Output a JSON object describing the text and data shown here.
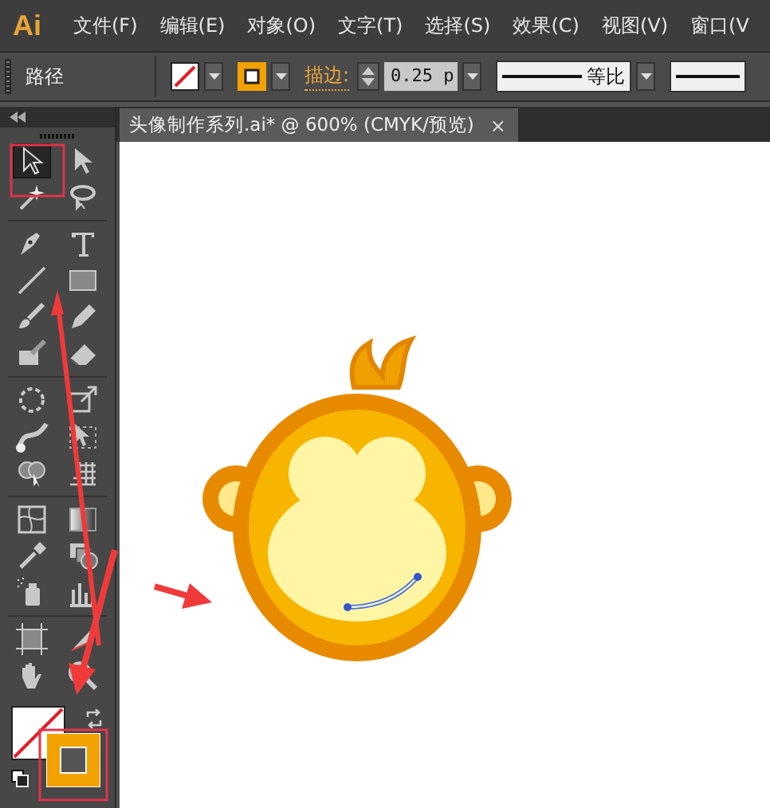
{
  "app_logo": "Ai",
  "menu": [
    "文件(F)",
    "编辑(E)",
    "对象(O)",
    "文字(T)",
    "选择(S)",
    "效果(C)",
    "视图(V)",
    "窗口(V"
  ],
  "control_bar": {
    "label": "路径",
    "stroke_label": "描边:",
    "stroke_weight": "0.25 p",
    "profile": "等比"
  },
  "document_tab": {
    "title": "头像制作系列.ai* @ 600% (CMYK/预览)",
    "close": "×"
  },
  "tools": [
    {
      "kind": "select",
      "selected": true
    },
    {
      "kind": "direct",
      "selected": false
    },
    {
      "kind": "wand",
      "selected": false
    },
    {
      "kind": "lasso",
      "selected": false
    },
    {
      "kind": "pen",
      "selected": false
    },
    {
      "kind": "type",
      "selected": false
    },
    {
      "kind": "line",
      "selected": false
    },
    {
      "kind": "rect",
      "selected": false
    },
    {
      "kind": "brush",
      "selected": false
    },
    {
      "kind": "pencil",
      "selected": false
    },
    {
      "kind": "blob",
      "selected": false
    },
    {
      "kind": "eraser",
      "selected": false
    },
    {
      "kind": "rotate",
      "selected": false
    },
    {
      "kind": "scale",
      "selected": false
    },
    {
      "kind": "warp",
      "selected": false
    },
    {
      "kind": "transform",
      "selected": false
    },
    {
      "kind": "builder",
      "selected": false
    },
    {
      "kind": "grid",
      "selected": false
    },
    {
      "kind": "mesh",
      "selected": false
    },
    {
      "kind": "gradient",
      "selected": false
    },
    {
      "kind": "eyedropper",
      "selected": false
    },
    {
      "kind": "blend",
      "selected": false
    },
    {
      "kind": "sprayer",
      "selected": false
    },
    {
      "kind": "graph",
      "selected": false
    },
    {
      "kind": "artboard",
      "selected": false
    },
    {
      "kind": "slice",
      "selected": false
    },
    {
      "kind": "hand",
      "selected": false
    },
    {
      "kind": "zoom",
      "selected": false
    }
  ]
}
